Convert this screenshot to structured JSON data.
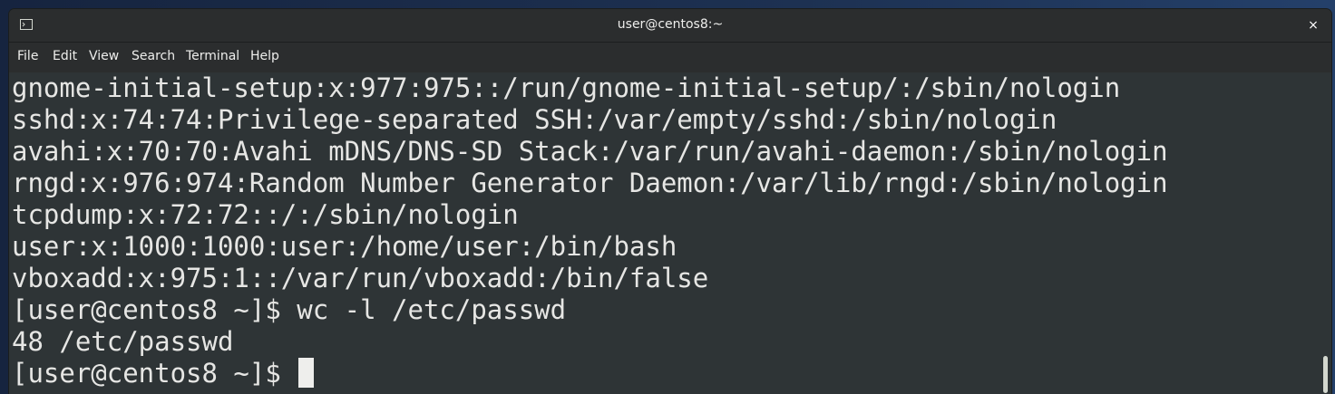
{
  "window": {
    "title": "user@centos8:~",
    "close_label": "×"
  },
  "menu": {
    "items": [
      "File",
      "Edit",
      "View",
      "Search",
      "Terminal",
      "Help"
    ]
  },
  "terminal": {
    "lines": [
      "gnome-initial-setup:x:977:975::/run/gnome-initial-setup/:/sbin/nologin",
      "sshd:x:74:74:Privilege-separated SSH:/var/empty/sshd:/sbin/nologin",
      "avahi:x:70:70:Avahi mDNS/DNS-SD Stack:/var/run/avahi-daemon:/sbin/nologin",
      "rngd:x:976:974:Random Number Generator Daemon:/var/lib/rngd:/sbin/nologin",
      "tcpdump:x:72:72::/:/sbin/nologin",
      "user:x:1000:1000:user:/home/user:/bin/bash",
      "vboxadd:x:975:1::/var/run/vboxadd:/bin/false",
      "[user@centos8 ~]$ wc -l /etc/passwd",
      "48 /etc/passwd"
    ],
    "prompt": "[user@centos8 ~]$ "
  },
  "icons": {
    "window_icon": "terminal-icon",
    "close": "close-icon"
  },
  "colors": {
    "terminal_bg": "#2e3436",
    "terminal_fg": "#e6e6e4",
    "titlebar_bg": "#2b2d2e"
  }
}
